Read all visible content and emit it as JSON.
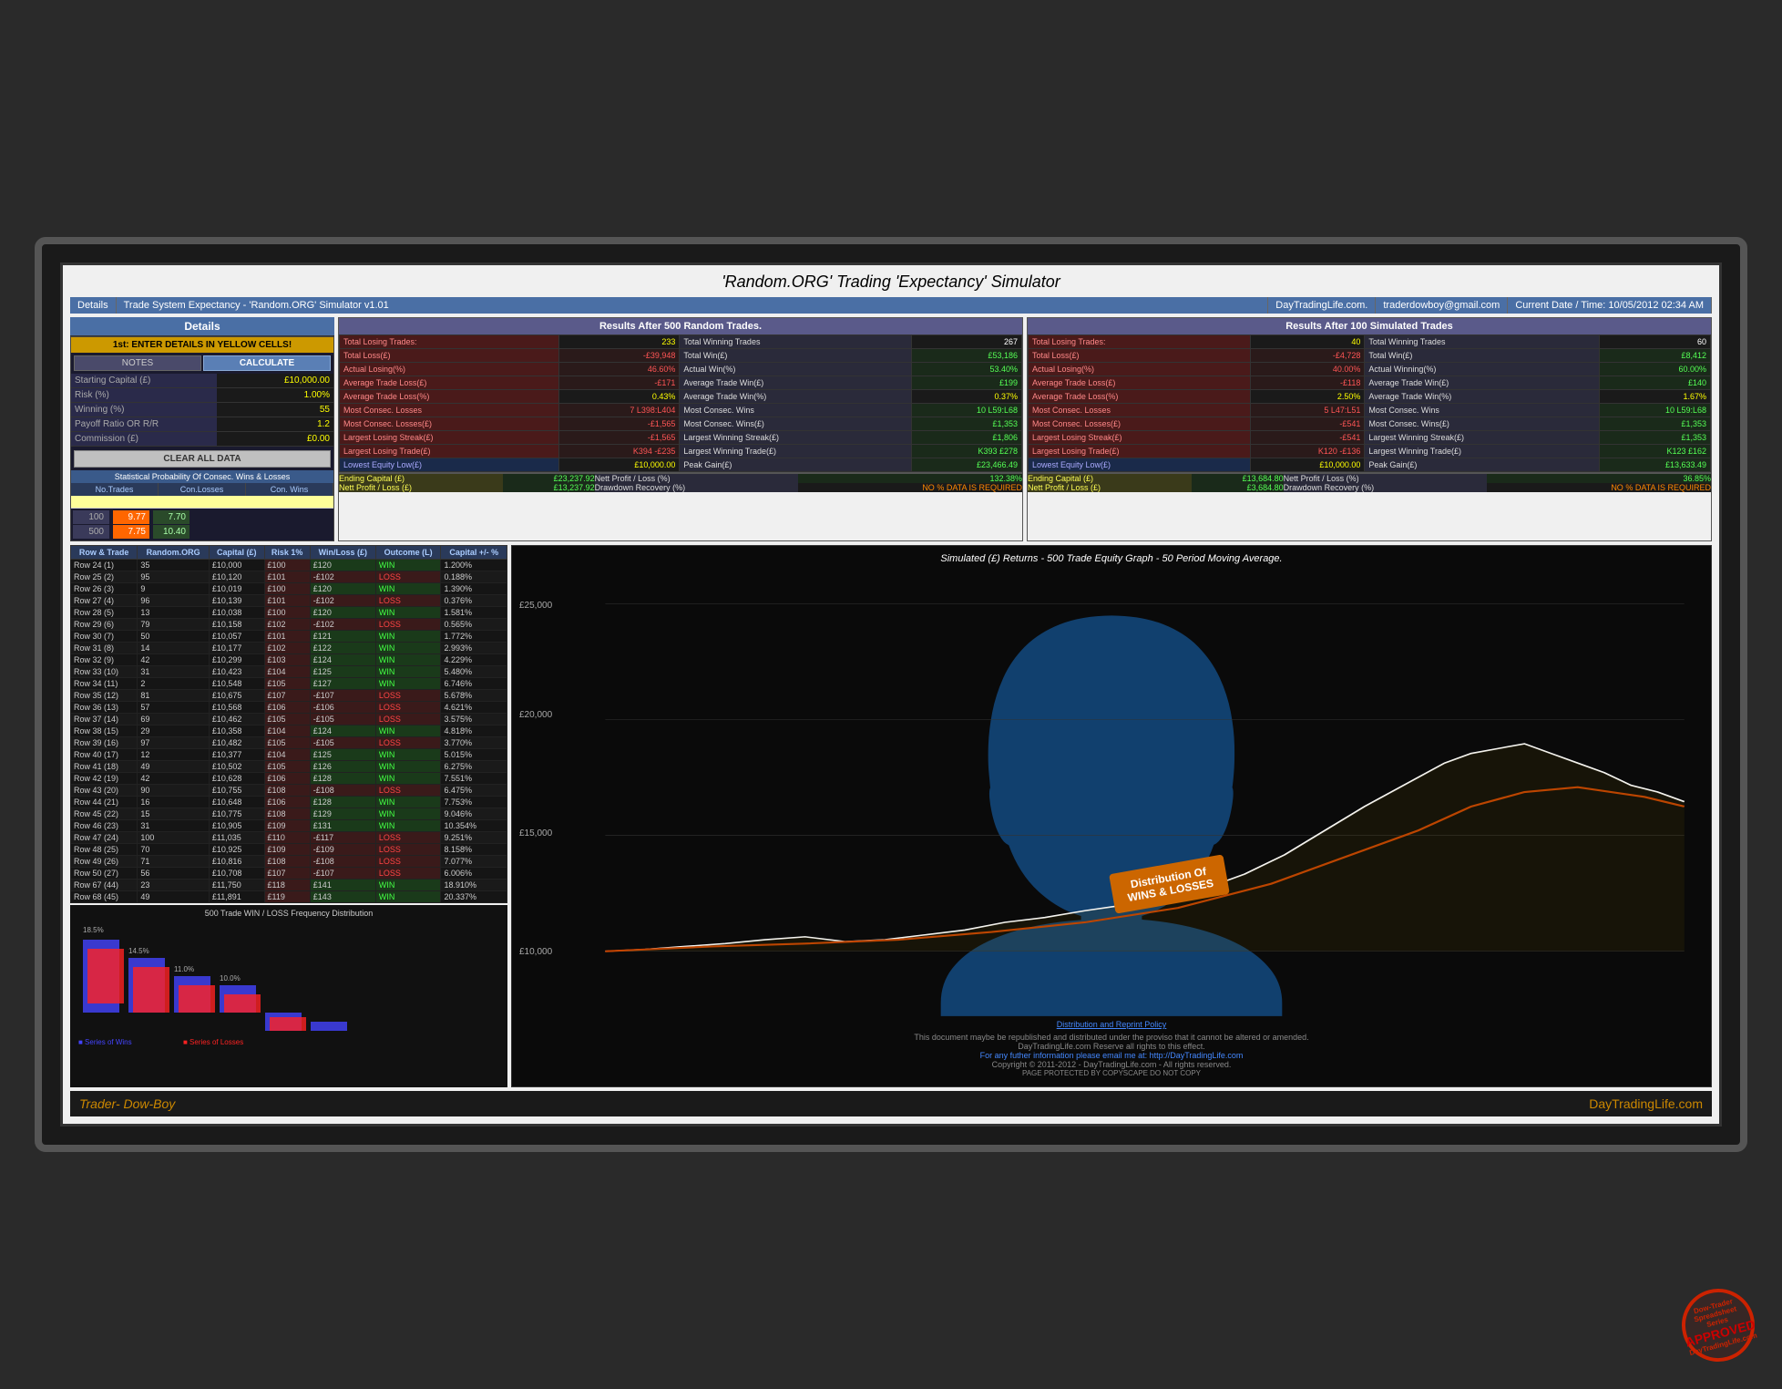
{
  "title": "'Random.ORG' Trading 'Expectancy' Simulator",
  "topbar": {
    "details": "Details",
    "tradeSystem": "Trade System Expectancy - 'Random.ORG' Simulator v1.01",
    "site": "DayTradingLife.com.",
    "email": "traderdowboy@gmail.com",
    "dateTime": "Current Date / Time: 10/05/2012 02:34 AM"
  },
  "details": {
    "header": "Details",
    "enterDetails": "1st: ENTER DETAILS IN YELLOW CELLS!",
    "notesLabel": "NOTES",
    "calculateLabel": "CALCULATE",
    "fields": [
      {
        "label": "Starting Capital (£)",
        "value": "£10,000.00"
      },
      {
        "label": "Risk (%)",
        "value": "1.00%"
      },
      {
        "label": "Winning  (%)",
        "value": "55"
      },
      {
        "label": "Payoff Ratio OR R/R",
        "value": "1.2"
      },
      {
        "label": "Commission (£)",
        "value": "£0.00"
      }
    ],
    "clearAllData": "CLEAR ALL DATA",
    "statProb": "Statistical Probability Of Consec. Wins & Losses",
    "cols": [
      "No.Trades",
      "Con.Losses",
      "Con. Wins"
    ],
    "simRows": [
      {
        "trades": "100",
        "consLoss": "9.77",
        "consWins": "7.70"
      },
      {
        "trades": "500",
        "consLoss": "7.75",
        "consWins": "10.40"
      }
    ]
  },
  "results500": {
    "header": "Results After 500 Random Trades.",
    "items": [
      {
        "label": "Total Losing Trades:",
        "value": "233",
        "labelClass": "r-label-red"
      },
      {
        "label": "Total Winning Trades",
        "value": "267",
        "valClass": "r-val-white"
      },
      {
        "label": "Total Loss(£)",
        "value": "-£39,948",
        "labelClass": "r-label-red",
        "valClass": "r-val-red"
      },
      {
        "label": "Total Win(£)",
        "value": "£53,186",
        "valClass": "r-val-green"
      },
      {
        "label": "Actual Losing(%)",
        "value": "46.60%",
        "labelClass": "r-label-red",
        "valClass": "r-val-red"
      },
      {
        "label": "Actual Win(%)",
        "value": "53.40%",
        "valClass": "r-val-green"
      },
      {
        "label": "Average Trade Loss(£)",
        "value": "-£171",
        "labelClass": "r-label-red",
        "valClass": "r-val-red"
      },
      {
        "label": "Average Trade Win(£)",
        "value": "£199",
        "valClass": "r-val-green"
      },
      {
        "label": "Average Trade Loss(%)",
        "value": "0.43%",
        "labelClass": "r-label-red"
      },
      {
        "label": "Average Trade Win(%)",
        "value": "0.37%",
        "valClass": "r-val"
      },
      {
        "label": "Most Consec. Losses",
        "value": "7  L398:L404",
        "labelClass": "r-label-red",
        "valClass": "r-val-red"
      },
      {
        "label": "Most Consec. Wins",
        "value": "10  L59:L68",
        "valClass": "r-val-green"
      },
      {
        "label": "Most Consec. Losses(£)",
        "value": "-£1,565",
        "labelClass": "r-label-red",
        "valClass": "r-val-red"
      },
      {
        "label": "Most Consec. Wins(£)",
        "value": "£1,353",
        "valClass": "r-val-green"
      },
      {
        "label": "Largest Losing Streak(£)",
        "value": "-£1,565",
        "labelClass": "r-label-red",
        "valClass": "r-val-red"
      },
      {
        "label": "Largest Winning Streak(£)",
        "value": "£1,806",
        "valClass": "r-val-green"
      },
      {
        "label": "Largest Losing Trade(£)",
        "value": "K394  -£235",
        "labelClass": "r-label-red",
        "valClass": "r-val-red"
      },
      {
        "label": "Largest Winning Trade(£)",
        "value": "K393  £278",
        "valClass": "r-val-green"
      },
      {
        "label": "Lowest Equity Low(£)",
        "value": "£10,000.00",
        "labelClass": "r-label-blue"
      },
      {
        "label": "Peak Gain(£)",
        "value": "£23,466.49",
        "valClass": "r-val-green"
      }
    ],
    "ending": {
      "endingCapital": "£23,237.92",
      "nettProfitLabel": "Nett Profit / Loss (%)",
      "nettProfit": "132.38%",
      "nettProfitPoundLabel": "Nett Profit / Loss (£)",
      "nettProfitPound": "£13,237.92",
      "drawdownLabel": "Drawdown Recovery (%)",
      "drawdown": "NO % DATA IS REQUIRED"
    }
  },
  "results100": {
    "header": "Results After 100 Simulated Trades",
    "items": [
      {
        "label": "Total Losing Trades:",
        "value": "40",
        "labelClass": "r-label-red"
      },
      {
        "label": "Total Winning Trades",
        "value": "60",
        "valClass": "r-val-white"
      },
      {
        "label": "Total Loss(£)",
        "value": "-£4,728",
        "labelClass": "r-label-red",
        "valClass": "r-val-red"
      },
      {
        "label": "Total Win(£)",
        "value": "£8,412",
        "valClass": "r-val-green"
      },
      {
        "label": "Actual Losing(%)",
        "value": "40.00%",
        "labelClass": "r-label-red",
        "valClass": "r-val-red"
      },
      {
        "label": "Actual Winning(%)",
        "value": "60.00%",
        "valClass": "r-val-green"
      },
      {
        "label": "Average Trade Loss(£)",
        "value": "-£118",
        "labelClass": "r-label-red",
        "valClass": "r-val-red"
      },
      {
        "label": "Average Trade Win(£)",
        "value": "£140",
        "valClass": "r-val-green"
      },
      {
        "label": "Average Trade Loss(%)",
        "value": "2.50%",
        "labelClass": "r-label-red"
      },
      {
        "label": "Average Trade Win(%)",
        "value": "1.67%"
      },
      {
        "label": "Most Consec. Losses",
        "value": "5  L47:L51",
        "labelClass": "r-label-red",
        "valClass": "r-val-red"
      },
      {
        "label": "Most Consec. Wins",
        "value": "10  L59:L68",
        "valClass": "r-val-green"
      },
      {
        "label": "Most Consec. Losses(£)",
        "value": "-£541",
        "labelClass": "r-label-red",
        "valClass": "r-val-red"
      },
      {
        "label": "Most Consec. Wins(£)",
        "value": "£1,353",
        "valClass": "r-val-green"
      },
      {
        "label": "Largest Losing Streak(£)",
        "value": "-£541",
        "labelClass": "r-label-red",
        "valClass": "r-val-red"
      },
      {
        "label": "Largest Winning Streak(£)",
        "value": "£1,353",
        "valClass": "r-val-green"
      },
      {
        "label": "Largest Losing Trade(£)",
        "value": "K120  -£136",
        "labelClass": "r-label-red",
        "valClass": "r-val-red"
      },
      {
        "label": "Largest Winning Trade(£)",
        "value": "K123  £162",
        "valClass": "r-val-green"
      },
      {
        "label": "Lowest Equity Low(£)",
        "value": "£10,000.00",
        "labelClass": "r-label-blue"
      },
      {
        "label": "Peak Gain(£)",
        "value": "£13,633.49",
        "valClass": "r-val-green"
      }
    ],
    "ending": {
      "endingCapital": "£13,684.80",
      "nettProfitLabel": "Nett Profit / Loss (%)",
      "nettProfit": "36.85%",
      "nettProfitPoundLabel": "Nett Profit / Loss (£)",
      "nettProfitPound": "£3,684.80",
      "drawdownLabel": "Drawdown Recovery (%)",
      "drawdown": "NO % DATA IS REQUIRED"
    }
  },
  "tableHeaders": [
    "Row & Trade",
    "Random.ORG",
    "Capital (£)",
    "Risk 1%",
    "Win/Loss (£)",
    "Outcome (L)",
    "Capital +/- %"
  ],
  "tableRows": [
    {
      "row": "Row 24 (1)",
      "random": "35",
      "capital": "£10,000",
      "risk": "£100",
      "winLoss": "£120",
      "outcome": "WIN",
      "capPct": "1.200%"
    },
    {
      "row": "Row 25 (2)",
      "random": "95",
      "capital": "£10,120",
      "risk": "£101",
      "winLoss": "-£102",
      "outcome": "LOSS",
      "capPct": "0.188%"
    },
    {
      "row": "Row 26 (3)",
      "random": "9",
      "capital": "£10,019",
      "risk": "£100",
      "winLoss": "£120",
      "outcome": "WIN",
      "capPct": "1.390%"
    },
    {
      "row": "Row 27 (4)",
      "random": "96",
      "capital": "£10,139",
      "risk": "£101",
      "winLoss": "-£102",
      "outcome": "LOSS",
      "capPct": "0.376%"
    },
    {
      "row": "Row 28 (5)",
      "random": "13",
      "capital": "£10,038",
      "risk": "£100",
      "winLoss": "£120",
      "outcome": "WIN",
      "capPct": "1.581%"
    },
    {
      "row": "Row 29 (6)",
      "random": "79",
      "capital": "£10,158",
      "risk": "£102",
      "winLoss": "-£102",
      "outcome": "LOSS",
      "capPct": "0.565%"
    },
    {
      "row": "Row 30 (7)",
      "random": "50",
      "capital": "£10,057",
      "risk": "£101",
      "winLoss": "£121",
      "outcome": "WIN",
      "capPct": "1.772%"
    },
    {
      "row": "Row 31 (8)",
      "random": "14",
      "capital": "£10,177",
      "risk": "£102",
      "winLoss": "£122",
      "outcome": "WIN",
      "capPct": "2.993%"
    },
    {
      "row": "Row 32 (9)",
      "random": "42",
      "capital": "£10,299",
      "risk": "£103",
      "winLoss": "£124",
      "outcome": "WIN",
      "capPct": "4.229%"
    },
    {
      "row": "Row 33 (10)",
      "random": "31",
      "capital": "£10,423",
      "risk": "£104",
      "winLoss": "£125",
      "outcome": "WIN",
      "capPct": "5.480%"
    },
    {
      "row": "Row 34 (11)",
      "random": "2",
      "capital": "£10,548",
      "risk": "£105",
      "winLoss": "£127",
      "outcome": "WIN",
      "capPct": "6.746%"
    },
    {
      "row": "Row 35 (12)",
      "random": "81",
      "capital": "£10,675",
      "risk": "£107",
      "winLoss": "-£107",
      "outcome": "LOSS",
      "capPct": "5.678%"
    },
    {
      "row": "Row 36 (13)",
      "random": "57",
      "capital": "£10,568",
      "risk": "£106",
      "winLoss": "-£106",
      "outcome": "LOSS",
      "capPct": "4.621%"
    },
    {
      "row": "Row 37 (14)",
      "random": "69",
      "capital": "£10,462",
      "risk": "£105",
      "winLoss": "-£105",
      "outcome": "LOSS",
      "capPct": "3.575%"
    },
    {
      "row": "Row 38 (15)",
      "random": "29",
      "capital": "£10,358",
      "risk": "£104",
      "winLoss": "£124",
      "outcome": "WIN",
      "capPct": "4.818%"
    },
    {
      "row": "Row 39 (16)",
      "random": "97",
      "capital": "£10,482",
      "risk": "£105",
      "winLoss": "-£105",
      "outcome": "LOSS",
      "capPct": "3.770%"
    },
    {
      "row": "Row 40 (17)",
      "random": "12",
      "capital": "£10,377",
      "risk": "£104",
      "winLoss": "£125",
      "outcome": "WIN",
      "capPct": "5.015%"
    },
    {
      "row": "Row 41 (18)",
      "random": "49",
      "capital": "£10,502",
      "risk": "£105",
      "winLoss": "£126",
      "outcome": "WIN",
      "capPct": "6.275%"
    },
    {
      "row": "Row 42 (19)",
      "random": "42",
      "capital": "£10,628",
      "risk": "£106",
      "winLoss": "£128",
      "outcome": "WIN",
      "capPct": "7.551%"
    },
    {
      "row": "Row 43 (20)",
      "random": "90",
      "capital": "£10,755",
      "risk": "£108",
      "winLoss": "-£108",
      "outcome": "LOSS",
      "capPct": "6.475%"
    },
    {
      "row": "Row 44 (21)",
      "random": "16",
      "capital": "£10,648",
      "risk": "£106",
      "winLoss": "£128",
      "outcome": "WIN",
      "capPct": "7.753%"
    },
    {
      "row": "Row 45 (22)",
      "random": "15",
      "capital": "£10,775",
      "risk": "£108",
      "winLoss": "£129",
      "outcome": "WIN",
      "capPct": "9.046%"
    },
    {
      "row": "Row 46 (23)",
      "random": "31",
      "capital": "£10,905",
      "risk": "£109",
      "winLoss": "£131",
      "outcome": "WIN",
      "capPct": "10.354%"
    },
    {
      "row": "Row 47 (24)",
      "random": "100",
      "capital": "£11,035",
      "risk": "£110",
      "winLoss": "-£117",
      "outcome": "LOSS",
      "capPct": "9.251%"
    },
    {
      "row": "Row 48 (25)",
      "random": "70",
      "capital": "£10,925",
      "risk": "£109",
      "winLoss": "-£109",
      "outcome": "LOSS",
      "capPct": "8.158%"
    },
    {
      "row": "Row 49 (26)",
      "random": "71",
      "capital": "£10,816",
      "risk": "£108",
      "winLoss": "-£108",
      "outcome": "LOSS",
      "capPct": "7.077%"
    },
    {
      "row": "Row 50 (27)",
      "random": "56",
      "capital": "£10,708",
      "risk": "£107",
      "winLoss": "-£107",
      "outcome": "LOSS",
      "capPct": "6.006%"
    },
    {
      "row": "Row 67 (44)",
      "random": "23",
      "capital": "£11,750",
      "risk": "£118",
      "winLoss": "£141",
      "outcome": "WIN",
      "capPct": "18.910%"
    },
    {
      "row": "Row 68 (45)",
      "random": "49",
      "capital": "£11,891",
      "risk": "£119",
      "winLoss": "£143",
      "outcome": "WIN",
      "capPct": "20.337%"
    }
  ],
  "chartTitle": "Simulated (£) Returns - 500 Trade Equity Graph - 50 Period Moving Average.",
  "chartYLabels": [
    "£25,000",
    "£20,000",
    "£15,000",
    "£10,000"
  ],
  "distributionLabel": "Distribution Of\nWINS & LOSSES",
  "barChartTitle": "500 Trade WIN / LOSS Frequency Distribution",
  "footer": {
    "left": "Trader- Dow-Boy",
    "right": "DayTradingLife.com",
    "stampLines": [
      "Dow-Trader",
      "Spreadsheet Series",
      "APPROVED",
      "DayTradingLife.com"
    ]
  },
  "policy": {
    "title": "Distribution and Reprint Policy",
    "text1": "This document maybe be republished and distributed under the proviso that it cannot be altered or amended.",
    "text2": "DayTradingLife.com Reserve all rights to this effect.",
    "text3": "For any futher information please email me at: http://DayTradingLife.com",
    "copyright": "Copyright © 2011-2012 - DayTradingLife.com - All rights reserved.",
    "protected": "PAGE PROTECTED BY COPYSCAPE DO NOT COPY"
  }
}
